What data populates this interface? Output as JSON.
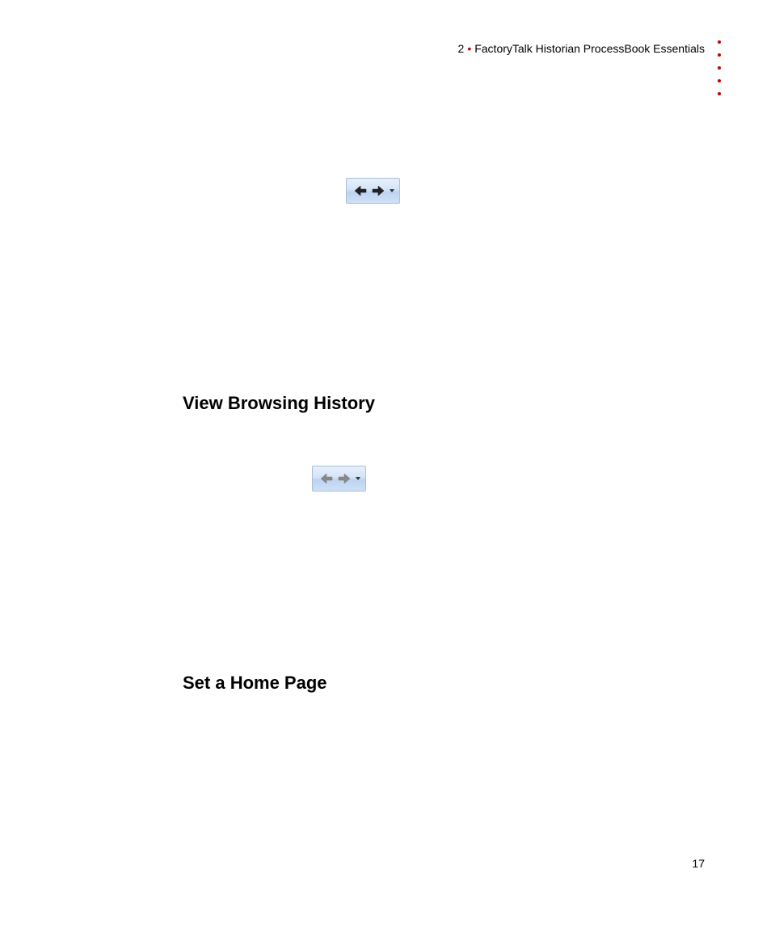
{
  "header": {
    "chapter_number": "2",
    "chapter_title": "FactoryTalk Historian ProcessBook Essentials"
  },
  "sections": {
    "view_browsing_history": "View Browsing History",
    "set_home_page": "Set a Home Page"
  },
  "page_number": "17"
}
